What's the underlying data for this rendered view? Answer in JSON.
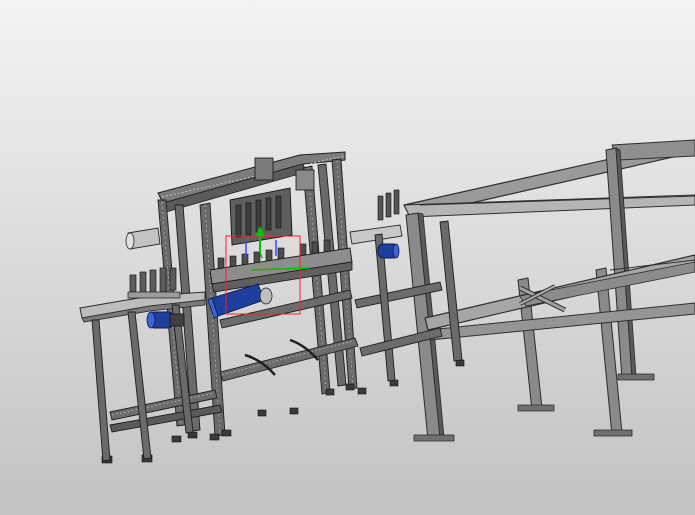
{
  "viewport": {
    "background_top": "#f3f3f3",
    "background_bottom": "#c2c2c2"
  },
  "colors": {
    "frame_dark": "#2a2a2a",
    "frame_mid": "#6f6f6f",
    "frame_light": "#b3b3b3",
    "selection_red": "#ff2020",
    "axis_green": "#00c000",
    "motor_blue": "#1e3f9e",
    "motor_blue_light": "#3b66d8"
  },
  "model": {
    "parts": [
      "assembly-line-frame",
      "dispensing-station",
      "left-conveyor-table",
      "right-conveyor",
      "open-steel-rack"
    ],
    "selection_box": "selection-box",
    "axis_triad": "axis-triad",
    "motors": [
      "drive-motor-left",
      "drive-motor-center",
      "drive-motor-right"
    ]
  }
}
